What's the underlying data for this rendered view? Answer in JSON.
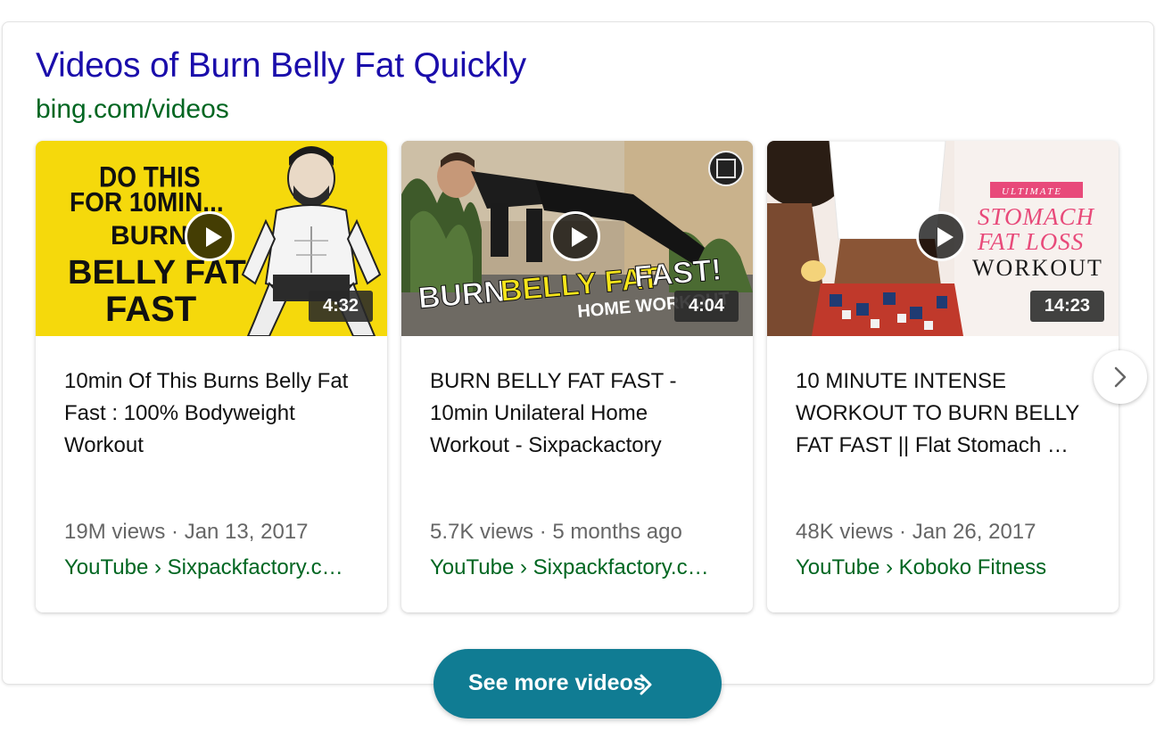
{
  "header": {
    "title": "Videos of Burn Belly Fat Quickly",
    "source": "bing.com/videos"
  },
  "videos": [
    {
      "title": "10min Of This Burns Belly Fat Fast : 100% Bodyweight Workout",
      "duration": "4:32",
      "views": "19M views",
      "date": "Jan 13, 2017",
      "meta": "19M views · Jan 13, 2017",
      "channel": "YouTube › Sixpackfactory.c…",
      "thumb_text": [
        "DO THIS",
        "FOR 10MIN...",
        "BURN",
        "BELLY FAT",
        "FAST"
      ]
    },
    {
      "title": "BURN BELLY FAT FAST - 10min Unilateral Home Workout - Sixpackactory",
      "duration": "4:04",
      "views": "5.7K views",
      "date": "5 months ago",
      "meta": "5.7K views · 5 months ago",
      "channel": "YouTube › Sixpackfactory.c…",
      "thumb_text": [
        "BURN",
        "BELLY FAT",
        "FAST!",
        "HOME WORKOUT"
      ]
    },
    {
      "title": "10 MINUTE INTENSE WORKOUT TO BURN BELLY FAT FAST || Flat Stomach …",
      "duration": "14:23",
      "views": "48K views",
      "date": "Jan 26, 2017",
      "meta": "48K views · Jan 26, 2017",
      "channel": "YouTube › Koboko Fitness",
      "thumb_text": [
        "ULTIMATE",
        "STOMACH",
        "FAT LOSS",
        "WORKOUT"
      ]
    }
  ],
  "see_more_label": "See more videos",
  "icons": {
    "play": "play-icon",
    "next": "chevron-right-icon",
    "see_more": "chevron-right-icon"
  },
  "colors": {
    "title_link": "#1a0dab",
    "source_green": "#006621",
    "button_teal": "#107c93"
  }
}
